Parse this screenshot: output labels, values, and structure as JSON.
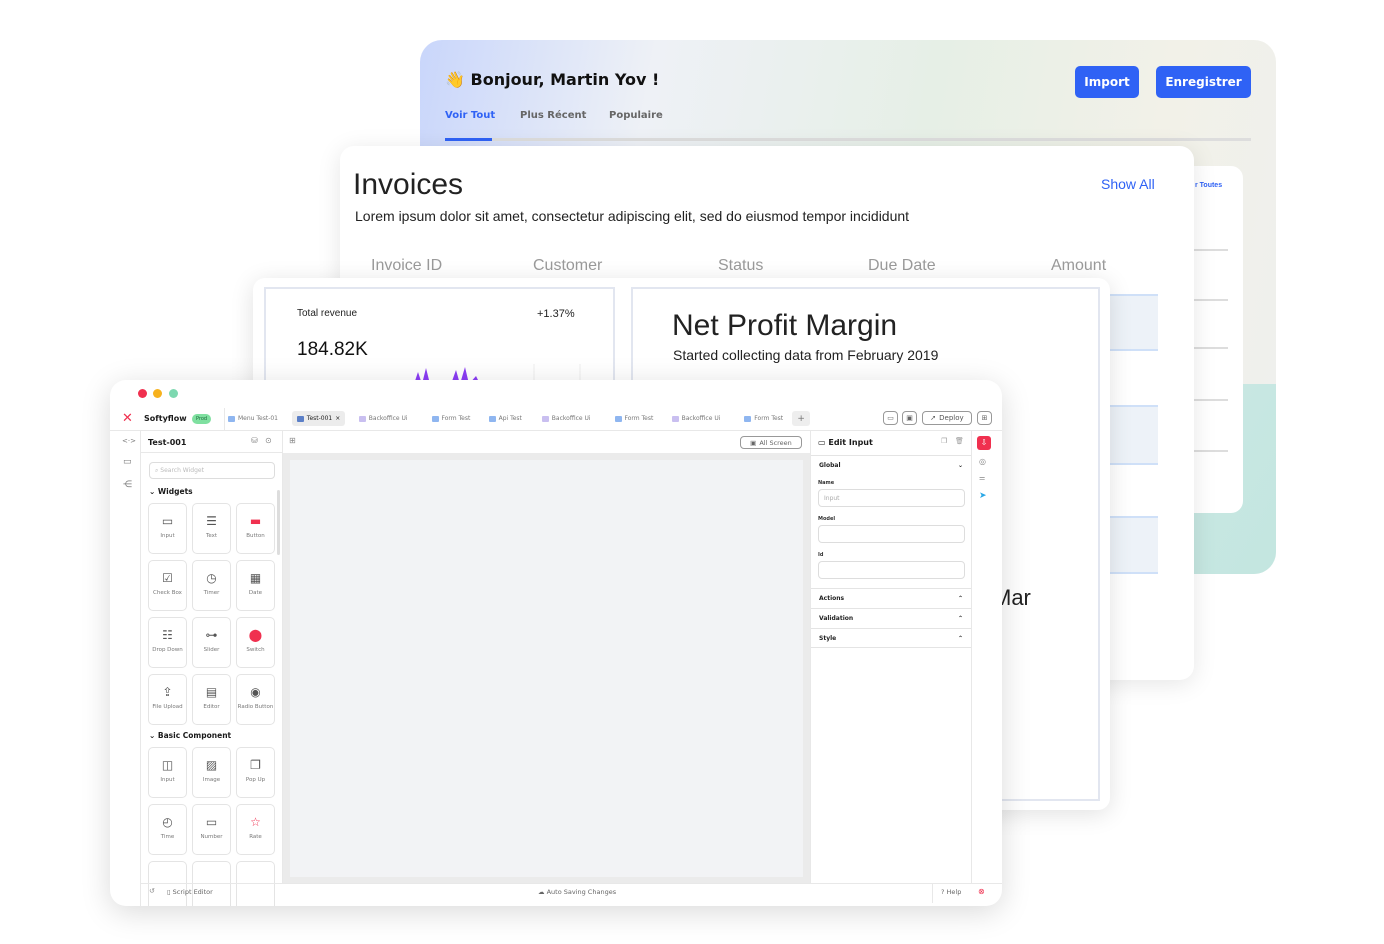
{
  "back": {
    "greeting": "Bonjour, Martin Yov !",
    "wave_icon": "👋",
    "import_label": "Import",
    "save_label": "Enregistrer",
    "tabs": [
      "Voir Tout",
      "Plus Récent",
      "Populaire"
    ],
    "active_tab": "Voir Tout",
    "side_link": "r Toutes",
    "accent": "#2f62f5"
  },
  "invoices": {
    "title": "Invoices",
    "subtitle": "Lorem ipsum dolor sit amet, consectetur adipiscing elit, sed do eiusmod tempor incididunt",
    "show_all": "Show All",
    "columns": [
      "Invoice ID",
      "Customer",
      "Status",
      "Due Date",
      "Amount"
    ]
  },
  "dashboard": {
    "revenue_label": "Total revenue",
    "revenue_change": "+1.37%",
    "revenue_value": "184.82K",
    "npm_title": "Net Profit Margin",
    "npm_subtitle": "Started collecting data from February 2019",
    "month_label": "Mar"
  },
  "builder": {
    "app_name": "Softyflow",
    "env_badge": "Prod",
    "tabs": [
      {
        "label": "Menu Test-01",
        "color": "#8fb6f0"
      },
      {
        "label": "Test-001",
        "color": "#5b7fc7",
        "active": true
      },
      {
        "label": "Backoffice Ui",
        "color": "#c9bff0"
      },
      {
        "label": "Form Test",
        "color": "#8fb6f0"
      },
      {
        "label": "Api Test",
        "color": "#8fb6f0"
      },
      {
        "label": "Backoffice Ui",
        "color": "#c9bff0"
      },
      {
        "label": "Form Test",
        "color": "#8fb6f0"
      },
      {
        "label": "Backoffice Ui",
        "color": "#c9bff0"
      },
      {
        "label": "Form Test",
        "color": "#8fb6f0"
      }
    ],
    "tab_close": "×",
    "add_tab": "+",
    "deploy_label": "Deploy",
    "page_name": "Test-001",
    "search_placeholder": "Search Widget",
    "all_screen": "All Screen",
    "widgets_title": "Widgets",
    "widgets": [
      {
        "label": "Input",
        "icon": "▭"
      },
      {
        "label": "Text",
        "icon": "☰"
      },
      {
        "label": "Button",
        "icon": "▬"
      },
      {
        "label": "Check Box",
        "icon": "☑"
      },
      {
        "label": "Timer",
        "icon": "◷"
      },
      {
        "label": "Date",
        "icon": "▦"
      },
      {
        "label": "Drop Down",
        "icon": "☷"
      },
      {
        "label": "Slider",
        "icon": "⊶"
      },
      {
        "label": "Switch",
        "icon": "⬤"
      },
      {
        "label": "File Upload",
        "icon": "⇪"
      },
      {
        "label": "Editor",
        "icon": "▤"
      },
      {
        "label": "Radio Button",
        "icon": "◉"
      }
    ],
    "basic_title": "Basic Component",
    "basic": [
      {
        "label": "Input",
        "icon": "◫"
      },
      {
        "label": "Image",
        "icon": "▨"
      },
      {
        "label": "Pop Up",
        "icon": "❐"
      },
      {
        "label": "Time",
        "icon": "◴"
      },
      {
        "label": "Number",
        "icon": "▭"
      },
      {
        "label": "Rate",
        "icon": "☆"
      },
      {
        "label": "",
        "icon": ""
      },
      {
        "label": "",
        "icon": ""
      },
      {
        "label": "",
        "icon": ""
      }
    ],
    "panel": {
      "title": "Edit Input",
      "global": "Global",
      "name_label": "Name",
      "name_placeholder": "Input",
      "model_label": "Model",
      "id_label": "Id",
      "sections": [
        "Actions",
        "Validation",
        "Style"
      ]
    },
    "footer": {
      "script_editor": "Script Editor",
      "autosave": "Auto Saving Changes",
      "help": "Help"
    },
    "accent": "#f0304f"
  }
}
